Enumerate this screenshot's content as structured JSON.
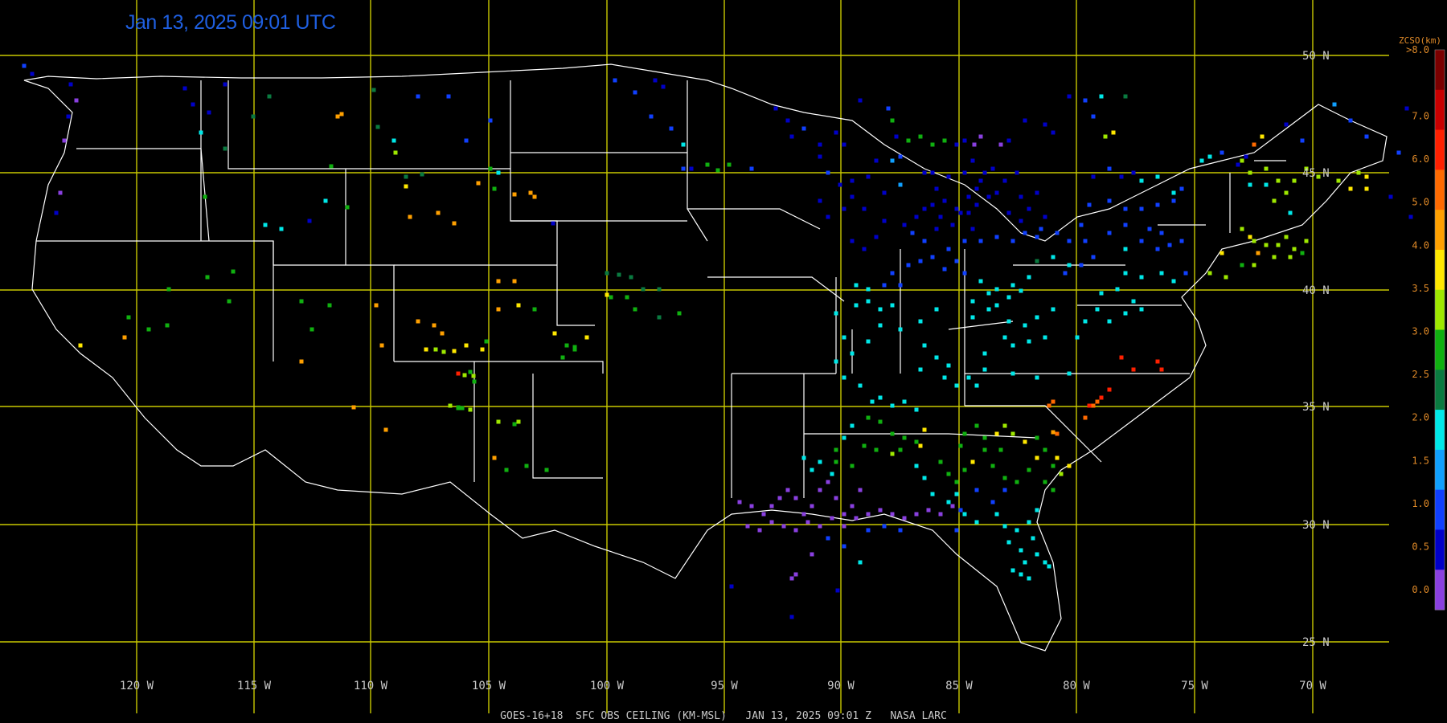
{
  "timestamp": "Jan 13, 2025 09:01 UTC",
  "footer": "GOES-16+18  SFC OBS CEILING (KM-MSL)   JAN 13, 2025 09:01 Z   NASA LARC",
  "colorbar": {
    "title": "ZCSO(km)",
    "labels": [
      ">8.0",
      "7.0",
      "6.0",
      "5.0",
      "4.0",
      "3.5",
      "3.0",
      "2.5",
      "2.0",
      "1.5",
      "1.0",
      "0.5",
      "0.0"
    ],
    "colors": [
      "#7a0000",
      "#c80000",
      "#ff2000",
      "#ff6a00",
      "#ffa000",
      "#ffe800",
      "#9ee800",
      "#10b010",
      "#0a7a40",
      "#00e8e8",
      "#10a0ff",
      "#1040ff",
      "#0000c8",
      "#8a40e0"
    ]
  },
  "lat_labels": [
    "50 N",
    "45 N",
    "40 N",
    "35 N",
    "30 N",
    "25 N"
  ],
  "lon_labels": [
    "120 W",
    "115 W",
    "110 W",
    "105 W",
    "100 W",
    "95 W",
    "90 W",
    "85 W",
    "80 W",
    "75 W",
    "70 W"
  ],
  "colors": {
    "grid": "#c8c800",
    "border": "#ffffff",
    "lat_label": "#c8c8c8"
  }
}
